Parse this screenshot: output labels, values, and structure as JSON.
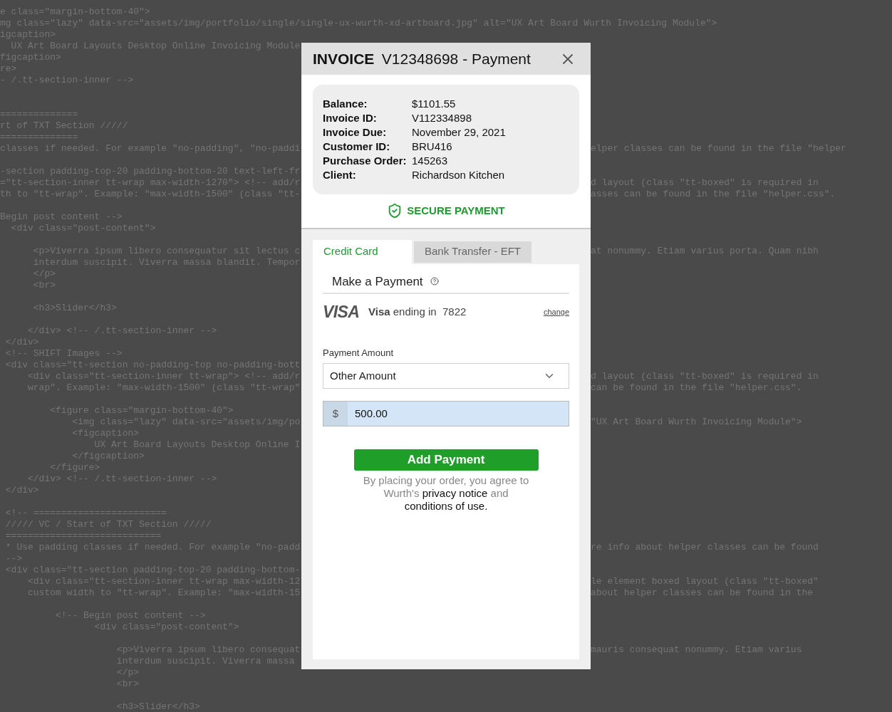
{
  "editor": {
    "top_lines": [
      "e class=\"margin-bottom-40\">",
      "mg class=\"lazy\" data-src=\"assets/img/portfolio/single/single-ux-wurth-xd-artboard.jpg\" alt=\"UX Art Board Wurth Invoicing Module\">",
      "igcaption>"
    ],
    "lines": [
      {
        "kind": "code",
        "left": "  UX Art Board Layouts Desktop Online Invoicing Module"
      },
      {
        "kind": "code",
        "left": "figcaption>"
      },
      {
        "kind": "code",
        "left": "re>"
      },
      {
        "kind": "code",
        "left": "- /.tt-section-inner -->"
      },
      {
        "kind": "blank"
      },
      {
        "kind": "blank"
      },
      {
        "kind": "code",
        "left": "=============="
      },
      {
        "kind": "code",
        "left": "rt of TXT Section /////"
      },
      {
        "kind": "code",
        "left": "=============="
      },
      {
        "kind": "code",
        "left": "classes if needed. For example \"no-padding\", \"no-paddi",
        "right": "elper classes can be found in the file \"helper"
      },
      {
        "kind": "blank"
      },
      {
        "kind": "code",
        "left": "-section padding-top-20 padding-bottom-20 text-left-fr"
      },
      {
        "kind": "code",
        "left": "=\"tt-section-inner tt-wrap max-width-1270\"> <!-- add/r",
        "right": "d layout (class \"tt-boxed\" is required in"
      },
      {
        "kind": "code",
        "left": "th to \"tt-wrap\". Example: \"max-width-1500\" (class \"tt-",
        "right": "asses can be found in the file \"helper.css\"."
      },
      {
        "kind": "blank"
      },
      {
        "kind": "code",
        "left": "Begin post content -->"
      },
      {
        "kind": "code",
        "left": "  <div class=\"post-content\">"
      },
      {
        "kind": "blank"
      },
      {
        "kind": "code",
        "left": "      <p>Viverra ipsum libero consequatur sit lectus c",
        "right": "at nonummy. Etiam varius porta. Quam nibh"
      },
      {
        "kind": "code",
        "left": "      interdum suscipit. Viverra massa blandit. Tempor"
      },
      {
        "kind": "code",
        "left": "      </p>"
      },
      {
        "kind": "code",
        "left": "      <br>"
      },
      {
        "kind": "blank"
      },
      {
        "kind": "code",
        "left": "      <h3>Slider</h3>"
      },
      {
        "kind": "blank"
      },
      {
        "kind": "code",
        "left": "     </div> <!-- /.tt-section-inner -->"
      },
      {
        "kind": "code",
        "left": " </div>"
      },
      {
        "kind": "code",
        "left": " <!-- SHIFT Images -->"
      },
      {
        "kind": "code",
        "left": " <div class=\"tt-section no-padding-top no-padding-bott"
      },
      {
        "kind": "code",
        "left": "     <div class=\"tt-section-inner tt-wrap\"> <!-- add/r",
        "right": "d layout (class \"tt-boxed\" is required in"
      },
      {
        "kind": "code",
        "left": "     wrap\". Example: \"max-width-1500\" (class \"tt-wrap\"",
        "right": "can be found in the file \"helper.css\"."
      },
      {
        "kind": "blank"
      },
      {
        "kind": "code",
        "left": "         <figure class=\"margin-bottom-40\">"
      },
      {
        "kind": "code",
        "left": "             <img class=\"lazy\" data-src=\"assets/img/po",
        "right": "\"UX Art Board Wurth Invoicing Module\">"
      },
      {
        "kind": "code",
        "left": "             <figcaption>"
      },
      {
        "kind": "code",
        "left": "                 UX Art Board Layouts Desktop Online I"
      },
      {
        "kind": "code",
        "left": "             </figcaption>"
      },
      {
        "kind": "code",
        "left": "         </figure>"
      },
      {
        "kind": "code",
        "left": "     </div> <!-- /.tt-section-inner -->"
      },
      {
        "kind": "code",
        "left": " </div>"
      },
      {
        "kind": "blank"
      },
      {
        "kind": "code",
        "left": " <!-- ========================"
      },
      {
        "kind": "code",
        "left": " ///// VC / Start of TXT Section /////"
      },
      {
        "kind": "code",
        "left": " ============================"
      },
      {
        "kind": "code",
        "left": " * Use padding classes if needed. For example \"no-padd",
        "right": "re info about helper classes can be found"
      },
      {
        "kind": "code",
        "left": " -->"
      },
      {
        "kind": "code",
        "left": " <div class=\"tt-section padding-top-20 padding-bottom-"
      },
      {
        "kind": "code",
        "left": "     <div class=\"tt-section-inner tt-wrap max-width-12",
        "right": "le element boxed layout (class \"tt-boxed\""
      },
      {
        "kind": "code",
        "left": "     custom width to \"tt-wrap\". Example: \"max-width-15",
        "right": "about helper classes can be found in the"
      },
      {
        "kind": "blank"
      },
      {
        "kind": "code",
        "left": "          <!-- Begin post content -->"
      },
      {
        "kind": "code",
        "left": "                 <div class=\"post-content\">"
      },
      {
        "kind": "blank"
      },
      {
        "kind": "code",
        "left": "                     <p>Viverra ipsum libero consequat",
        "right": "mauris consequat nonummy. Etiam varius"
      },
      {
        "kind": "code",
        "left": "                     interdum suscipit. Viverra massa"
      },
      {
        "kind": "code",
        "left": "                     </p>"
      },
      {
        "kind": "code",
        "left": "                     <br>"
      },
      {
        "kind": "blank"
      },
      {
        "kind": "code",
        "left": "                     <h3>Slider</h3>"
      }
    ]
  },
  "dialog": {
    "title_bold": "INVOICE",
    "title": "V12348698 - Payment",
    "details": [
      {
        "label": "Balance:",
        "value": "$1101.55"
      },
      {
        "label": "Invoice ID:",
        "value": "V112334898"
      },
      {
        "label": "Invoice Due:",
        "value": "November 29, 2021"
      },
      {
        "label": "Customer ID:",
        "value": "BRU416"
      },
      {
        "label": "Purchase Order:",
        "value": "145263"
      },
      {
        "label": "Client:",
        "value": "Richardson Kitchen"
      }
    ],
    "secure_label": "SECURE PAYMENT",
    "tabs": [
      {
        "label": "Credit Card",
        "selected": true
      },
      {
        "label": "Bank Transfer - EFT",
        "selected": false
      }
    ],
    "section_title": "Make a Payment",
    "card": {
      "brand": "VISA",
      "text": "**Visa** ending in  7822",
      "change": "change"
    },
    "amount_label": "Payment Amount",
    "amount_select": "Other Amount",
    "currency": "$",
    "amount_value": "500.00",
    "submit": "Add Payment",
    "agreement": {
      "before": "By placing your order, you agree to Wurth's",
      "privacy": "privacy notice",
      "middle": "and",
      "conditions": "conditions of use."
    }
  }
}
